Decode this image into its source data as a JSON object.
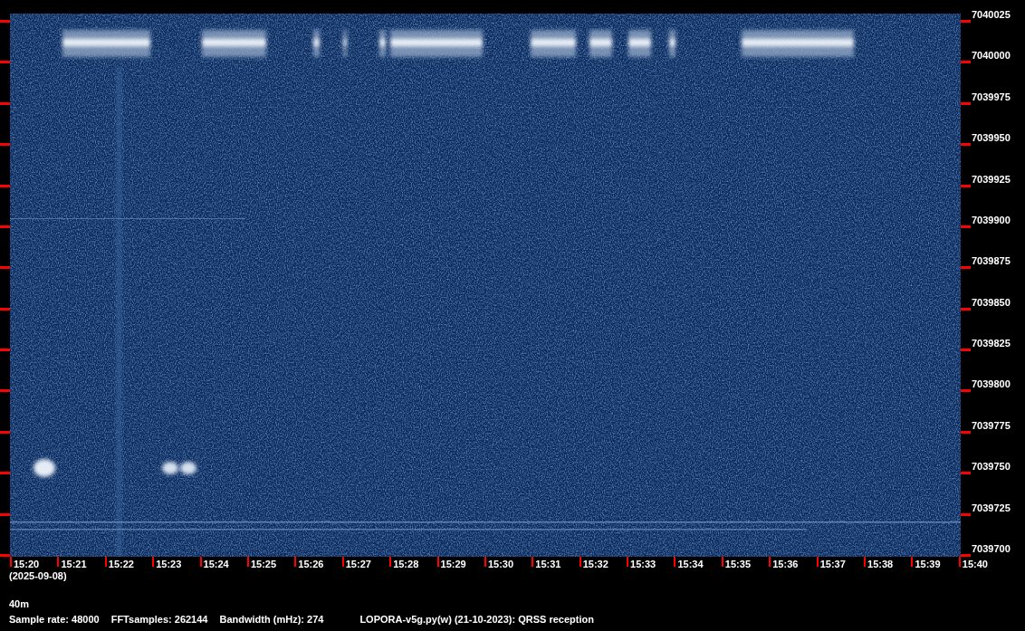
{
  "frequency_axis": {
    "labels": [
      "7040025",
      "7040000",
      "7039975",
      "7039950",
      "7039925",
      "7039900",
      "7039875",
      "7039850",
      "7039825",
      "7039800",
      "7039775",
      "7039750",
      "7039725",
      "7039700"
    ]
  },
  "time_axis": {
    "labels": [
      "15:20",
      "15:21",
      "15:22",
      "15:23",
      "15:24",
      "15:25",
      "15:26",
      "15:27",
      "15:28",
      "15:29",
      "15:30",
      "15:31",
      "15:32",
      "15:33",
      "15:34",
      "15:35",
      "15:36",
      "15:37",
      "15:38",
      "15:39",
      "15:40"
    ],
    "date": "(2025-09-08)"
  },
  "band": "40m",
  "info": [
    "Sample rate: 48000",
    "FFTsamples: 262144",
    "Bandwidth (mHz): 274",
    "LOPORA-v5g.py(w) (21-10-2023): QRSS reception"
  ]
}
